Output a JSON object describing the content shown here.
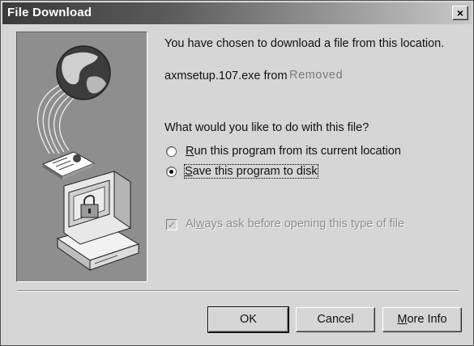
{
  "window": {
    "title": "File Download",
    "close_glyph": "×"
  },
  "message": {
    "line1": "You have chosen to download a file from this location.",
    "filename": "axmsetup.107.exe from",
    "source": "Removed",
    "question": "What would you like to do with this file?"
  },
  "options": {
    "run": {
      "mnemonic": "R",
      "rest": "un this program from its current location",
      "selected": false
    },
    "save": {
      "mnemonic": "S",
      "rest": "ave this program to disk",
      "selected": true
    }
  },
  "always_ask": {
    "pre": "Al",
    "mnemonic": "w",
    "rest": "ays ask before opening this type of file",
    "checked": true,
    "enabled": false
  },
  "buttons": {
    "ok": "OK",
    "cancel": "Cancel",
    "more_mnemonic": "M",
    "more_rest": "ore Info"
  },
  "icons": [
    "globe-icon",
    "document-icon",
    "computer-icon",
    "lock-icon",
    "close-icon"
  ]
}
